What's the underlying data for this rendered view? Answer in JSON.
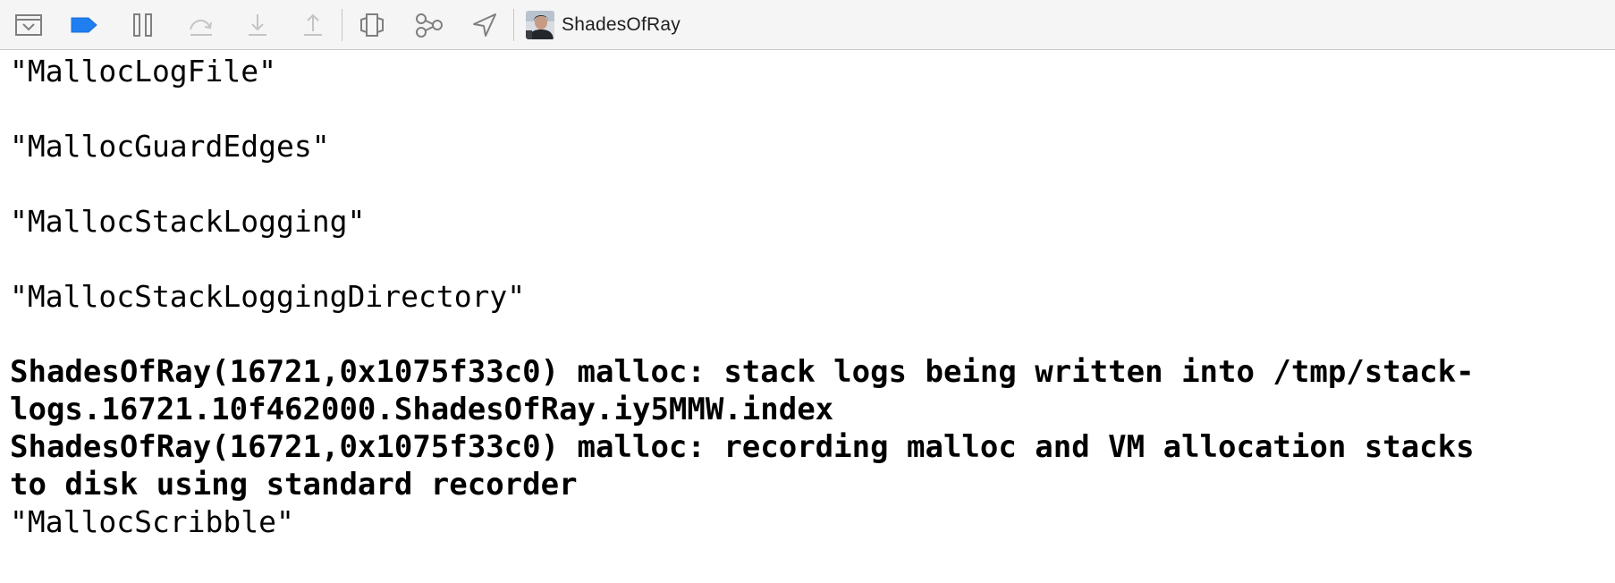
{
  "toolbar": {
    "buttons": [
      {
        "name": "hide-debug-area-button",
        "icon": "hide-panel-icon"
      },
      {
        "name": "breakpoints-toggle-button",
        "icon": "breakpoint-icon",
        "color": "#1f7ef0"
      },
      {
        "name": "pause-button",
        "icon": "pause-icon"
      },
      {
        "name": "step-over-button",
        "icon": "step-over-icon"
      },
      {
        "name": "step-into-button",
        "icon": "step-into-icon"
      },
      {
        "name": "step-out-button",
        "icon": "step-out-icon"
      },
      {
        "name": "debug-view-hierarchy-button",
        "icon": "view-hierarchy-icon"
      },
      {
        "name": "debug-memory-graph-button",
        "icon": "memory-graph-icon"
      },
      {
        "name": "simulate-location-button",
        "icon": "location-arrow-icon"
      }
    ],
    "scheme_label": "ShadesOfRay"
  },
  "console": {
    "lines": [
      "\"MallocLogFile\"",
      "\"MallocGuardEdges\"",
      "\"MallocStackLogging\"",
      "\"MallocStackLoggingDirectory\"",
      "ShadesOfRay(16721,0x1075f33c0) malloc: stack logs being written into /tmp/stack-",
      "logs.16721.10f462000.ShadesOfRay.iy5MMW.index",
      "ShadesOfRay(16721,0x1075f33c0) malloc: recording malloc and VM allocation stacks",
      "to disk using standard recorder",
      "\"MallocScribble\""
    ]
  },
  "colors": {
    "accent": "#1f7ef0",
    "icon": "#8a8a8a",
    "icon_disabled": "#c4c4c4",
    "toolbar_bg": "#f5f5f5"
  }
}
